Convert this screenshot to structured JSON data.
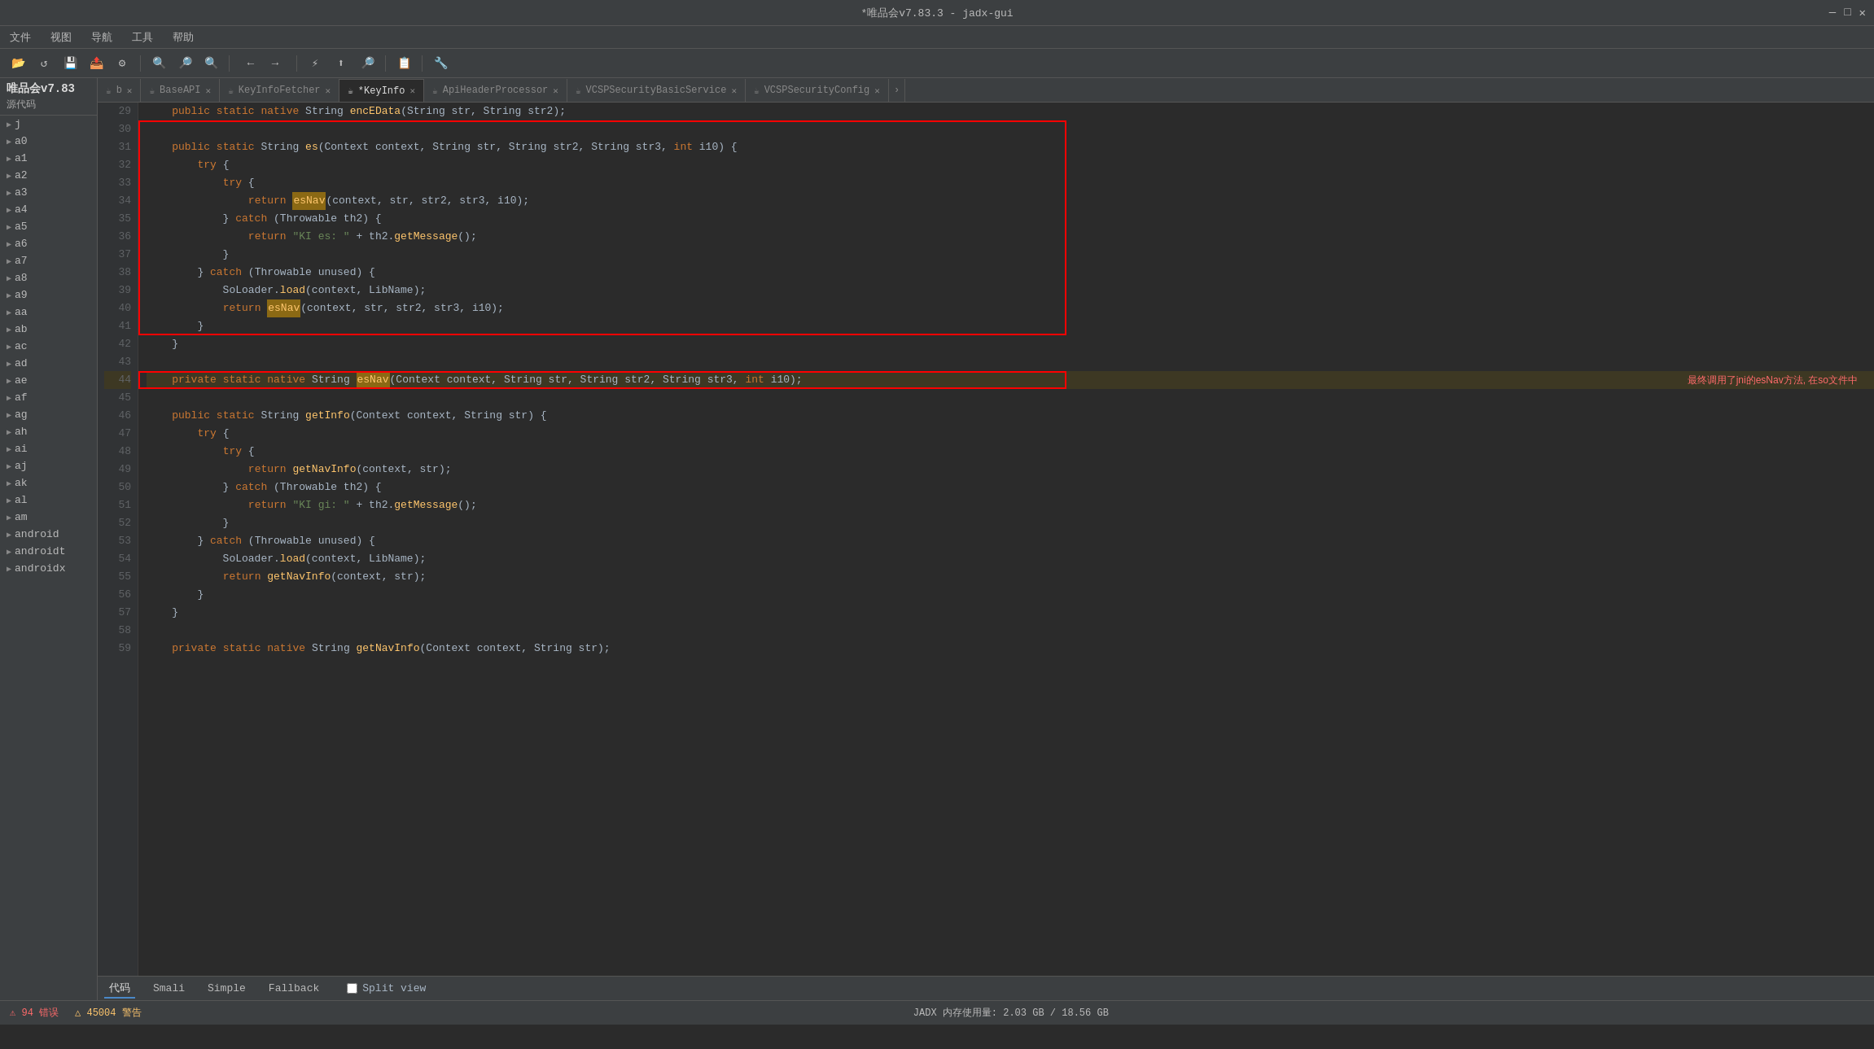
{
  "window": {
    "title": "*唯品会v7.83.3 - jadx-gui"
  },
  "titlebar": {
    "minimize": "—",
    "maximize": "□",
    "close": "✕"
  },
  "menu": {
    "items": [
      "文件",
      "视图",
      "导航",
      "工具",
      "帮助"
    ]
  },
  "app_title": "唯品会v7.83",
  "sidebar_header": "源代码",
  "sidebar_items": [
    {
      "label": "j",
      "expanded": false
    },
    {
      "label": "a0",
      "expanded": false
    },
    {
      "label": "a1",
      "expanded": false
    },
    {
      "label": "a2",
      "expanded": false
    },
    {
      "label": "a3",
      "expanded": false
    },
    {
      "label": "a4",
      "expanded": false
    },
    {
      "label": "a5",
      "expanded": false
    },
    {
      "label": "a6",
      "expanded": false
    },
    {
      "label": "a7",
      "expanded": false
    },
    {
      "label": "a8",
      "expanded": false
    },
    {
      "label": "a9",
      "expanded": false
    },
    {
      "label": "aa",
      "expanded": false
    },
    {
      "label": "ab",
      "expanded": false
    },
    {
      "label": "ac",
      "expanded": false
    },
    {
      "label": "ad",
      "expanded": false
    },
    {
      "label": "ae",
      "expanded": false
    },
    {
      "label": "af",
      "expanded": false
    },
    {
      "label": "ag",
      "expanded": false
    },
    {
      "label": "ah",
      "expanded": false
    },
    {
      "label": "ai",
      "expanded": false
    },
    {
      "label": "aj",
      "expanded": false
    },
    {
      "label": "ak",
      "expanded": false
    },
    {
      "label": "al",
      "expanded": false
    },
    {
      "label": "am",
      "expanded": false
    },
    {
      "label": "android",
      "expanded": false
    },
    {
      "label": "androidt",
      "expanded": false
    },
    {
      "label": "androidx",
      "expanded": false
    }
  ],
  "tabs": [
    {
      "label": "b",
      "active": false,
      "modified": false
    },
    {
      "label": "BaseAPI",
      "active": false,
      "modified": false
    },
    {
      "label": "KeyInfoFetcher",
      "active": false,
      "modified": false
    },
    {
      "label": "KeyInfo",
      "active": true,
      "modified": true
    },
    {
      "label": "ApiHeaderProcessor",
      "active": false,
      "modified": false
    },
    {
      "label": "VCSPSecurityBasicService",
      "active": false,
      "modified": false
    },
    {
      "label": "VCSPSecurityConfig",
      "active": false,
      "modified": false
    }
  ],
  "code": {
    "annotation": "最终调用了jni的esNav方法, 在so文件中",
    "lines": [
      {
        "num": 29,
        "content": "    public static native String encEData(String str, String str2);"
      },
      {
        "num": 30,
        "content": ""
      },
      {
        "num": 31,
        "content": "    public static String es(Context context, String str, String str2, String str3, int i10) {"
      },
      {
        "num": 32,
        "content": "        try {"
      },
      {
        "num": 33,
        "content": "            try {"
      },
      {
        "num": 34,
        "content": "                return esNav(context, str, str2, str3, i10);"
      },
      {
        "num": 35,
        "content": "            } catch (Throwable th2) {"
      },
      {
        "num": 36,
        "content": "                return \"KI es: \" + th2.getMessage();"
      },
      {
        "num": 37,
        "content": "            }"
      },
      {
        "num": 38,
        "content": "        } catch (Throwable unused) {"
      },
      {
        "num": 39,
        "content": "            SoLoader.load(context, LibName);"
      },
      {
        "num": 40,
        "content": "            return esNav(context, str, str2, str3, i10);"
      },
      {
        "num": 41,
        "content": "        }"
      },
      {
        "num": 42,
        "content": "    }"
      },
      {
        "num": 43,
        "content": ""
      },
      {
        "num": 44,
        "content": "    private static native String esNav(Context context, String str, String str2, String str3, int i10);"
      },
      {
        "num": 45,
        "content": ""
      },
      {
        "num": 46,
        "content": "    public static String getInfo(Context context, String str) {"
      },
      {
        "num": 47,
        "content": "        try {"
      },
      {
        "num": 48,
        "content": "            try {"
      },
      {
        "num": 49,
        "content": "                return getNavInfo(context, str);"
      },
      {
        "num": 50,
        "content": "            } catch (Throwable th2) {"
      },
      {
        "num": 51,
        "content": "                return \"KI gi: \" + th2.getMessage();"
      },
      {
        "num": 52,
        "content": "            }"
      },
      {
        "num": 53,
        "content": "        } catch (Throwable unused) {"
      },
      {
        "num": 54,
        "content": "            SoLoader.load(context, LibName);"
      },
      {
        "num": 55,
        "content": "            return getNavInfo(context, str);"
      },
      {
        "num": 56,
        "content": "        }"
      },
      {
        "num": 57,
        "content": "    }"
      },
      {
        "num": 58,
        "content": ""
      },
      {
        "num": 59,
        "content": "    private static native String getNavInfo(Context context, String str);"
      }
    ]
  },
  "bottom_tabs": [
    {
      "label": "代码",
      "active": true
    },
    {
      "label": "Smali",
      "active": false
    },
    {
      "label": "Simple",
      "active": false
    },
    {
      "label": "Fallback",
      "active": false
    }
  ],
  "status_bar": {
    "errors": "⚠ 94 错误",
    "warnings": "△ 45004 警告",
    "memory": "JADX 内存使用量: 2.03 GB / 18.56 GB"
  },
  "split_view": {
    "label": "Split view",
    "checked": false
  }
}
